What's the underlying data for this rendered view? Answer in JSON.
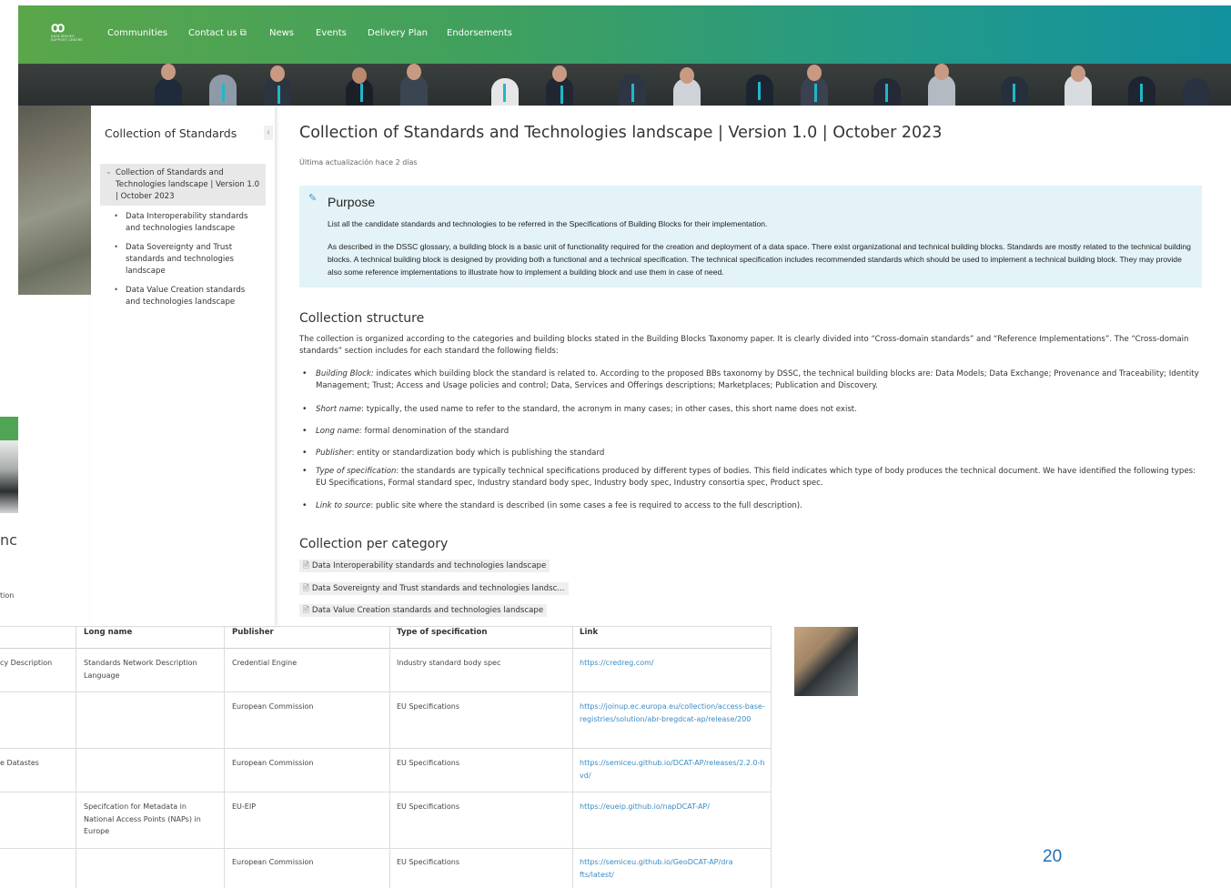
{
  "nav": {
    "logo_text": "DATA SPACES SUPPORT CENTRE",
    "items": [
      "Communities",
      "Contact us ⧉",
      "News",
      "Events",
      "Delivery Plan",
      "Endorsements"
    ]
  },
  "sidebar": {
    "title": "Collection of Standards",
    "collapse_icon": "‹",
    "active_item": "Collection of Standards and Technologies landscape | Version 1.0 | October 2023",
    "sub_items": [
      "Data Interoperability standards and technologies landscape",
      "Data Sovereignty and Trust standards and technologies landscape",
      "Data Value Creation standards and technologies landscape"
    ]
  },
  "main": {
    "title": "Collection of Standards and Technologies landscape | Version 1.0 | October 2023",
    "updated": "Última actualización hace 2 días",
    "purpose": {
      "title": "Purpose",
      "p1": "List all the candidate standards and technologies to be referred in the Specifications of Building Blocks for their implementation.",
      "p2": "As described in the DSSC glossary, a building block is a basic unit of functionality required for the creation and deployment of a data space. There exist organizational and technical building blocks. Standards are mostly related to the technical building blocks. A technical building block is designed by providing both a functional and a technical specification. The technical specification includes recommended standards which should be used to implement a technical building block. They may provide also some reference implementations to illustrate how to implement a building block and use them in case of need."
    },
    "structure": {
      "heading": "Collection structure",
      "intro": "The collection is organized according to the categories and building blocks stated in the Building Blocks Taxonomy paper. It is clearly divided into “Cross-domain standards” and “Reference Implementations”. The “Cross-domain standards” section includes for each standard the following fields:",
      "fields": [
        {
          "term": "Building Block:",
          "text": " indicates which building block the standard is related to. According to the proposed BBs taxonomy by DSSC, the technical building blocks are: Data Models; Data Exchange; Provenance and Traceability; Identity Management; Trust; Access and Usage policies and control; Data, Services and Offerings descriptions; Marketplaces; Publication and Discovery."
        },
        {
          "term": "Short name",
          "text": ": typically, the used name to refer to the standard, the acronym in many cases; in other cases, this short name does not exist."
        },
        {
          "term": "Long name:",
          "text": " formal denomination of the standard"
        },
        {
          "term": "Publisher",
          "text": ": entity or standardization body which is publishing the standard"
        },
        {
          "term": "Type of specification",
          "text": ": the standards are typically technical specifications produced by different types of bodies. This field indicates which type of body produces the technical document. We have identified the following types: EU Specifications, Formal standard spec, Industry standard body spec, Industry body spec, Industry consortia spec, Product spec."
        },
        {
          "term": "Link to source",
          "text": ": public site where the standard is described (in some cases a fee is required to access to the full description)."
        }
      ]
    },
    "category": {
      "heading": "Collection per category",
      "links": [
        "Data Interoperability standards and technologies landscape",
        "Data Sovereignty and Trust standards and technologies landsc...",
        "Data Value Creation standards and technologies landscape"
      ]
    }
  },
  "background": {
    "partial_word_1": "nc",
    "partial_word_2": "tion"
  },
  "table": {
    "headers": [
      "Long name",
      "Publisher",
      "Type of specification",
      "Link"
    ],
    "rows": [
      {
        "first": "cy Description",
        "long": "Standards Network Description Language",
        "publisher": "Credential Engine",
        "type": "Industry standard body spec",
        "link": "https://credreg.com/"
      },
      {
        "first": "",
        "long": "",
        "publisher": "European Commission",
        "type": "EU Specifications",
        "link": "https://joinup.ec.europa.eu/collection/access-base-registries/solution/abr-bregdcat-ap/release/200"
      },
      {
        "first": "e Datastes",
        "long": "",
        "publisher": "European Commission",
        "type": "EU Specifications",
        "link": "https://semiceu.github.io/DCAT-AP/releases/2.2.0-hvd/"
      },
      {
        "first": "",
        "long": "Specifcation for Metadata in National Access Points (NAPs) in Europe",
        "publisher": "EU-EIP",
        "type": "EU Specifications",
        "link": "https://eueip.github.io/napDCAT-AP/"
      },
      {
        "first": "",
        "long": "",
        "publisher": "European Commission",
        "type": "EU Specifications",
        "link": "https://semiceu.github.io/GeoDCAT-AP/drafts/latest/"
      }
    ]
  },
  "page_number": "20",
  "colors": {
    "nav_start": "#5aa64a",
    "nav_end": "#12929f",
    "purpose_bg": "#e3f3f7",
    "link": "#3a8bc4",
    "page_number": "#1f6fb4"
  }
}
